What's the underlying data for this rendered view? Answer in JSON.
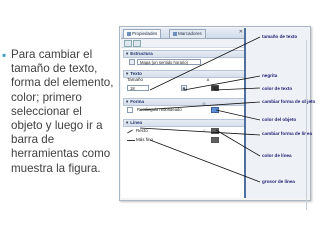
{
  "slide": {
    "bullet_text": "Para cambiar el tamaño de texto, forma del elemento, color; primero seleccionar el objeto y luego ir a barra de herramientas como muestra la figura."
  },
  "panel": {
    "tab_properties": "Propiedades",
    "tab_bookmarks": "Marcadores",
    "section_structure": "Estructura",
    "structure_value": "Mapa (un sentido horario)",
    "section_text": "Texto",
    "size_label": "Tamaño",
    "size_value": "18",
    "section_shape": "Forma",
    "shape_value": "Rectángulo redondeado",
    "section_line": "Línea",
    "line_label": "Recto",
    "line_width_label": "Más fino"
  },
  "annotations": {
    "text_size": "tamaño de texto",
    "bold": "negrita",
    "text_color": "color de texto",
    "object_shape": "cambiar forma de objeto",
    "object_color": "color del objeto",
    "line_shape": "cambiar forma de línea",
    "line_color": "color de línea",
    "line_width": "grosor de línea"
  },
  "colors": {
    "accent": "#40a0c0",
    "annotation": "#1d1d73",
    "shape_fill": "#5b8fd6",
    "line_color": "#606060"
  }
}
